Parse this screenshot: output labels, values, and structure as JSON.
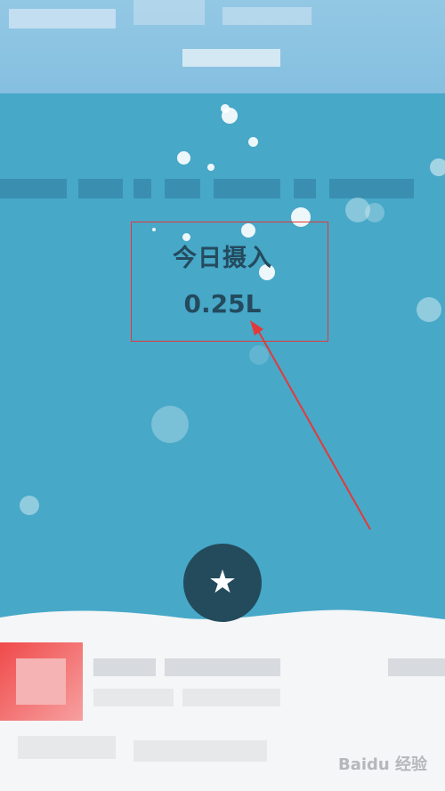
{
  "intake": {
    "label": "今日摄入",
    "value": "0.25L"
  },
  "favorite_button": {
    "icon": "star-icon",
    "glyph": "★"
  },
  "watermark": {
    "text": "Baidu 经验"
  },
  "colors": {
    "water": "#47a8c8",
    "top_banner": "#8dc4e2",
    "fab": "#234b5c",
    "text": "#244a5e",
    "annotation": "#e23a3a"
  }
}
